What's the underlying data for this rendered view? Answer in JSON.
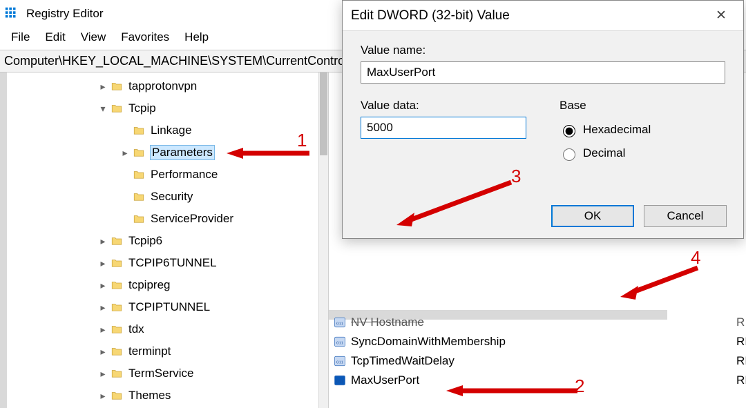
{
  "app": {
    "title": "Registry Editor",
    "titlebar_icon": "app-grid-icon"
  },
  "window_controls": {
    "min": "−",
    "max": "▢",
    "close": "✕"
  },
  "menu": [
    "File",
    "Edit",
    "View",
    "Favorites",
    "Help"
  ],
  "address": "Computer\\HKEY_LOCAL_MACHINE\\SYSTEM\\CurrentControlSet\\Services\\Tcpip\\Parameters",
  "tree": [
    {
      "indent": 1,
      "toggle": ">",
      "label": "tapprotonvpn"
    },
    {
      "indent": 1,
      "toggle": "v",
      "label": "Tcpip"
    },
    {
      "indent": 2,
      "toggle": "",
      "label": "Linkage"
    },
    {
      "indent": 2,
      "toggle": ">",
      "label": "Parameters",
      "selected": true
    },
    {
      "indent": 2,
      "toggle": "",
      "label": "Performance"
    },
    {
      "indent": 2,
      "toggle": "",
      "label": "Security"
    },
    {
      "indent": 2,
      "toggle": "",
      "label": "ServiceProvider"
    },
    {
      "indent": 1,
      "toggle": ">",
      "label": "Tcpip6"
    },
    {
      "indent": 1,
      "toggle": ">",
      "label": "TCPIP6TUNNEL"
    },
    {
      "indent": 1,
      "toggle": ">",
      "label": "tcpipreg"
    },
    {
      "indent": 1,
      "toggle": ">",
      "label": "TCPIPTUNNEL"
    },
    {
      "indent": 1,
      "toggle": ">",
      "label": "tdx"
    },
    {
      "indent": 1,
      "toggle": ">",
      "label": "terminpt"
    },
    {
      "indent": 1,
      "toggle": ">",
      "label": "TermService"
    },
    {
      "indent": 1,
      "toggle": ">",
      "label": "Themes"
    }
  ],
  "right_pane": {
    "rows": [
      {
        "icon": "reg-dword-icon",
        "name": "NV Hostname",
        "type_prefix": "R",
        "style": "cut"
      },
      {
        "icon": "reg-dword-icon",
        "name": "SyncDomainWithMembership",
        "type_prefix": "RI"
      },
      {
        "icon": "reg-dword-icon",
        "name": "TcpTimedWaitDelay",
        "type_prefix": "RI"
      },
      {
        "icon": "reg-dword-icon",
        "name": "MaxUserPort",
        "type_prefix": "RI",
        "selected": true
      }
    ]
  },
  "dialog": {
    "title": "Edit DWORD (32-bit) Value",
    "value_name_label": "Value name:",
    "value_name": "MaxUserPort",
    "value_data_label": "Value data:",
    "value_data": "5000",
    "base_label": "Base",
    "radio_hex": "Hexadecimal",
    "radio_dec": "Decimal",
    "ok": "OK",
    "cancel": "Cancel",
    "radio_selected": "hex",
    "close_glyph": "✕"
  },
  "annotations": {
    "1": "1",
    "2": "2",
    "3": "3",
    "4": "4"
  }
}
